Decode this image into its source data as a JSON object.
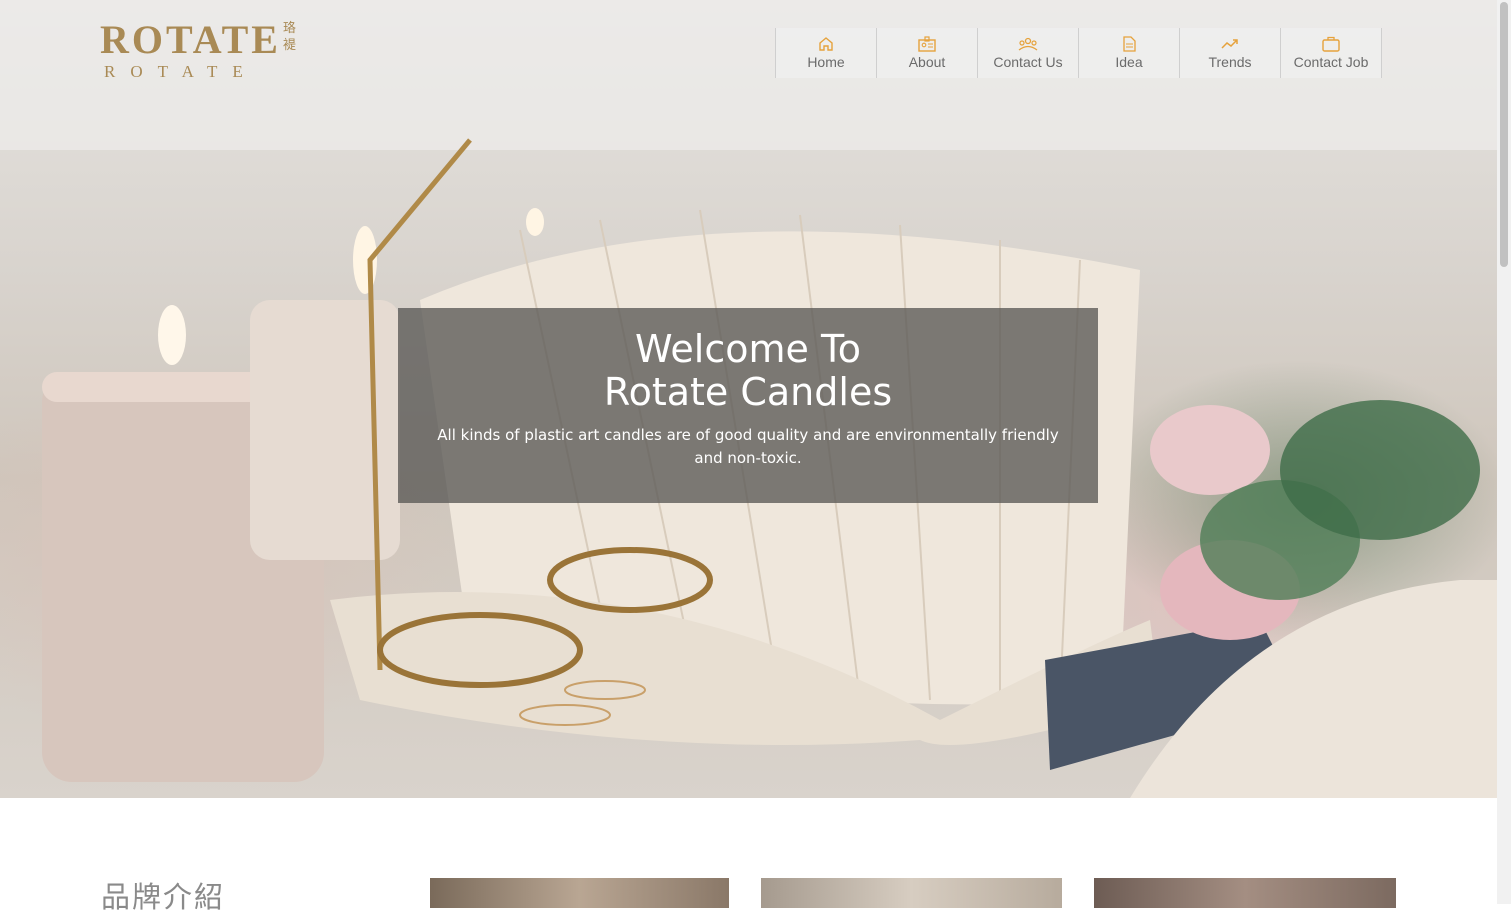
{
  "brand": {
    "logo_text": "ROTATE",
    "logo_subtext": "ROTATE",
    "logo_cjk": "珞褆",
    "color": "#a98a55"
  },
  "nav": {
    "items": [
      {
        "label": "Home",
        "icon": "home-icon"
      },
      {
        "label": "About",
        "icon": "id-card-icon"
      },
      {
        "label": "Contact Us",
        "icon": "people-icon"
      },
      {
        "label": "Idea",
        "icon": "document-icon"
      },
      {
        "label": "Trends",
        "icon": "trend-up-icon"
      },
      {
        "label": "Contact Job",
        "icon": "briefcase-icon"
      }
    ],
    "icon_color": "#e6a23c"
  },
  "hero": {
    "title_line1": "Welcome To",
    "title_line2": "Rotate Candles",
    "description": "All kinds of plastic art candles are of good quality and are environmentally friendly and non-toxic."
  },
  "brand_section": {
    "title": "品牌介紹"
  }
}
